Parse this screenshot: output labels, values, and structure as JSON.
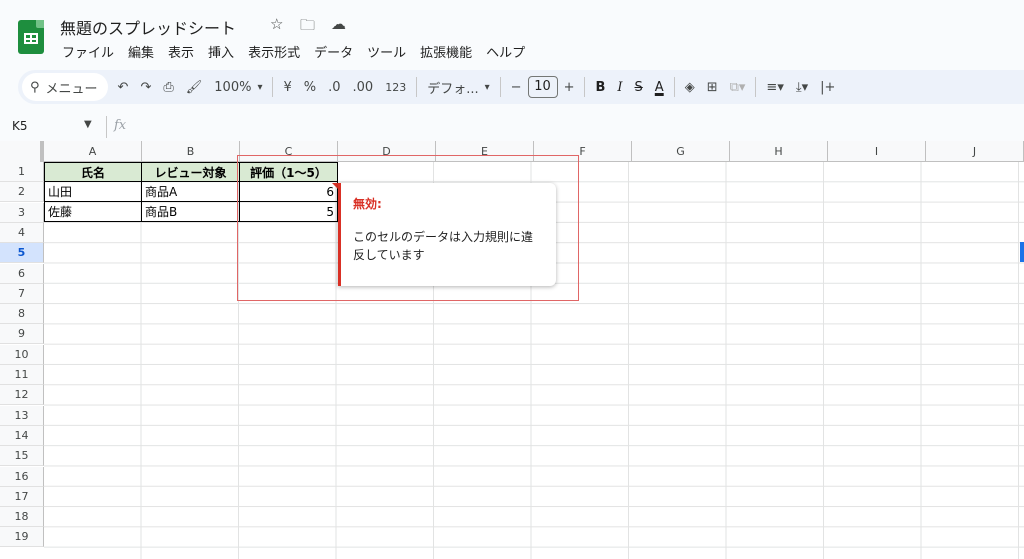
{
  "app": {
    "title": "無題のスプレッドシート"
  },
  "menu": [
    "ファイル",
    "編集",
    "表示",
    "挿入",
    "表示形式",
    "データ",
    "ツール",
    "拡張機能",
    "ヘルプ"
  ],
  "toolbar": {
    "search_label": "メニュー",
    "zoom": "100%",
    "currency": "¥",
    "percent": "%",
    "dec_decrease": ".0",
    "dec_increase": ".00",
    "number_format": "123",
    "font": "デフォ...",
    "font_size": "10",
    "bold": "B",
    "italic": "I",
    "strike": "S",
    "text_color": "A",
    "minus": "−",
    "plus": "+"
  },
  "formula_bar": {
    "name_box": "K5",
    "fx": "fx"
  },
  "columns": [
    "A",
    "B",
    "C",
    "D",
    "E",
    "F",
    "G",
    "H",
    "I",
    "J"
  ],
  "rows": [
    "1",
    "2",
    "3",
    "4",
    "5",
    "6",
    "7",
    "8",
    "9",
    "10",
    "11",
    "12",
    "13",
    "14",
    "15",
    "16",
    "17",
    "18",
    "19"
  ],
  "selected_row": "5",
  "table": {
    "headers": [
      "氏名",
      "レビュー対象",
      "評価（1〜5）"
    ],
    "rows": [
      [
        "山田",
        "商品A",
        "6"
      ],
      [
        "佐藤",
        "商品B",
        "5"
      ]
    ]
  },
  "validation_tooltip": {
    "title": "無効:",
    "message": "このセルのデータは入力規則に違反しています"
  },
  "colors": {
    "accent": "#1a73e8",
    "error": "#d93025",
    "header_fill": "#d9ead3",
    "sheets_green": "#1e8e3e"
  }
}
